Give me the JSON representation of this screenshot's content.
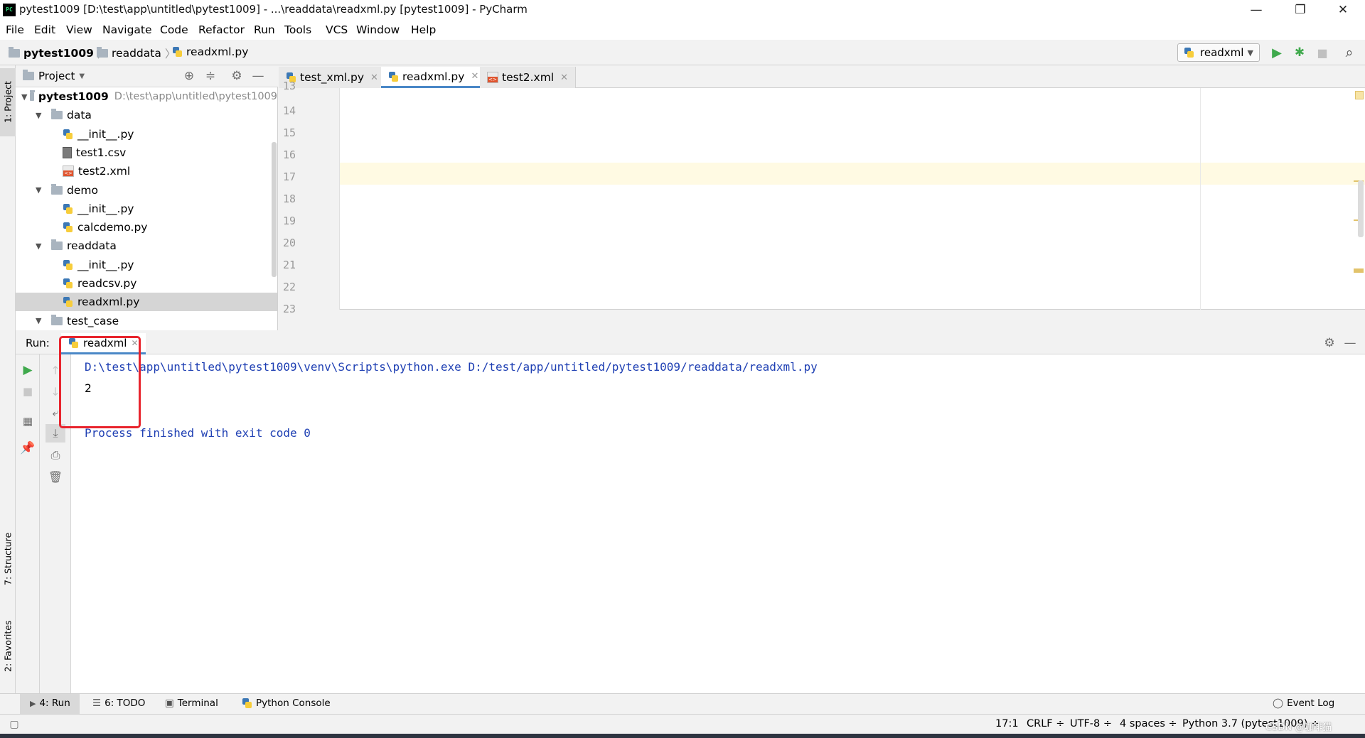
{
  "window": {
    "title": "pytest1009 [D:\\test\\app\\untitled\\pytest1009] - ...\\readdata\\readxml.py [pytest1009] - PyCharm",
    "app_icon": "PC"
  },
  "menu": [
    "File",
    "Edit",
    "View",
    "Navigate",
    "Code",
    "Refactor",
    "Run",
    "Tools",
    "VCS",
    "Window",
    "Help"
  ],
  "breadcrumb": {
    "project": "pytest1009",
    "folder": "readdata",
    "file": "readxml.py"
  },
  "run_config": "readxml",
  "left_stripe": {
    "project": "1: Project",
    "structure": "7: Structure",
    "favorites": "2: Favorites"
  },
  "project_panel": {
    "title": "Project",
    "tree": [
      {
        "label": "pytest1009",
        "path": "D:\\test\\app\\untitled\\pytest1009",
        "type": "root",
        "depth": 0
      },
      {
        "label": "data",
        "type": "folder",
        "depth": 1
      },
      {
        "label": "__init__.py",
        "type": "py",
        "depth": 2
      },
      {
        "label": "test1.csv",
        "type": "csv",
        "depth": 2
      },
      {
        "label": "test2.xml",
        "type": "xml",
        "depth": 2
      },
      {
        "label": "demo",
        "type": "folder",
        "depth": 1
      },
      {
        "label": "__init__.py",
        "type": "py",
        "depth": 2
      },
      {
        "label": "calcdemo.py",
        "type": "py",
        "depth": 2
      },
      {
        "label": "readdata",
        "type": "folder",
        "depth": 1
      },
      {
        "label": "__init__.py",
        "type": "py",
        "depth": 2
      },
      {
        "label": "readcsv.py",
        "type": "py",
        "depth": 2
      },
      {
        "label": "readxml.py",
        "type": "py",
        "depth": 2,
        "selected": true
      },
      {
        "label": "test_case",
        "type": "folder",
        "depth": 1
      }
    ]
  },
  "tabs": [
    {
      "label": "test_xml.py",
      "type": "py",
      "active": false
    },
    {
      "label": "readxml.py",
      "type": "py",
      "active": true
    },
    {
      "label": "test2.xml",
      "type": "xml",
      "active": false
    }
  ],
  "editor": {
    "line_numbers": [
      "13",
      "14",
      "15",
      "16",
      "17",
      "18",
      "19",
      "20",
      "21",
      "22",
      "23"
    ],
    "current_line": "17"
  },
  "run_panel": {
    "label": "Run:",
    "tab": "readxml",
    "output": [
      "D:\\test\\app\\untitled\\pytest1009\\venv\\Scripts\\python.exe D:/test/app/untitled/pytest1009/readdata/readxml.py",
      "2",
      "",
      "Process finished with exit code 0"
    ]
  },
  "bottom_tools": {
    "run": "4: Run",
    "todo": "6: TODO",
    "terminal": "Terminal",
    "python_console": "Python Console",
    "event_log": "Event Log"
  },
  "status": {
    "position": "17:1",
    "line_sep": "CRLF ÷",
    "encoding": "UTF-8 ÷",
    "indent": "4 spaces ÷",
    "interpreter": "Python 3.7 (pytest1009) ÷",
    "watermark": "CSDN @咖啡猫"
  },
  "colors": {
    "highlight_box": "#e8242d",
    "console_link": "#1e3fb3",
    "current_line": "#fffae3",
    "run_green": "#3fa94c"
  }
}
